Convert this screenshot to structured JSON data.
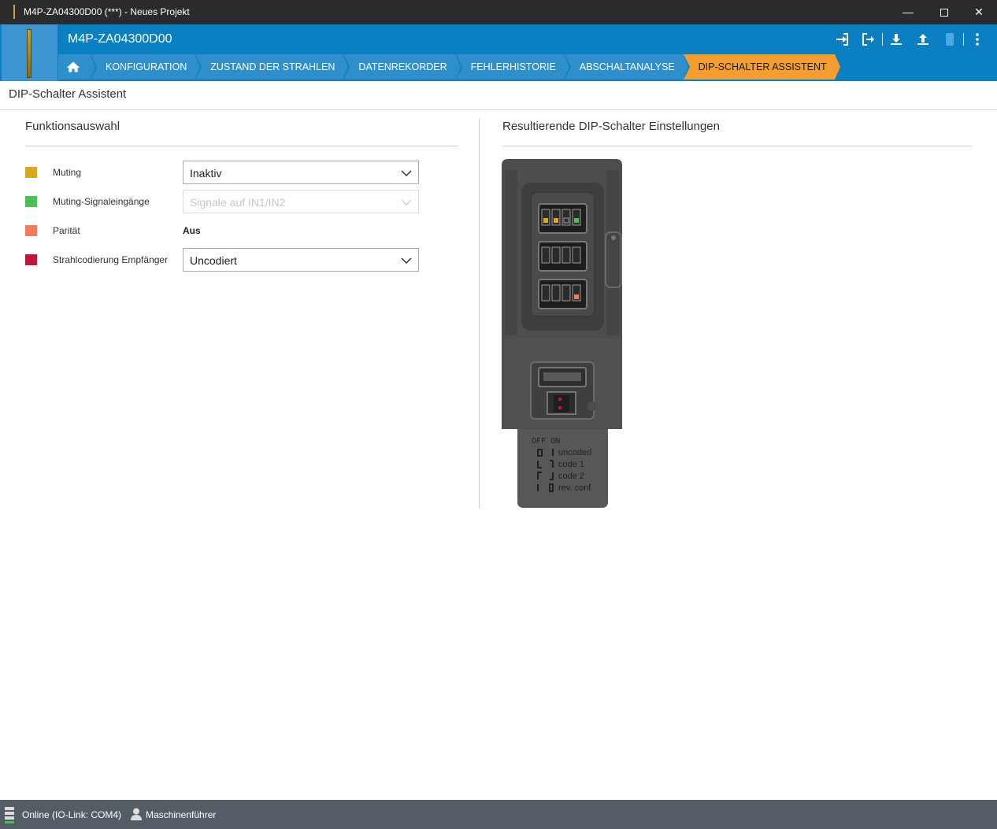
{
  "window": {
    "title": "M4P-ZA04300D00 (***) - Neues Projekt"
  },
  "header": {
    "device_name": "M4P-ZA04300D00",
    "icons": [
      "login-icon",
      "logout-icon",
      "download-icon",
      "upload-icon",
      "battery-icon",
      "more-vert-icon"
    ]
  },
  "nav": {
    "home_icon": "home-icon",
    "tabs": [
      {
        "label": "KONFIGURATION"
      },
      {
        "label": "ZUSTAND DER STRAHLEN"
      },
      {
        "label": "DATENREKORDER"
      },
      {
        "label": "FEHLERHISTORIE"
      },
      {
        "label": "ABSCHALTANALYSE"
      },
      {
        "label": "DIP-SCHALTER ASSISTENT",
        "active": true
      }
    ]
  },
  "page": {
    "title": "DIP-Schalter Assistent"
  },
  "left": {
    "title": "Funktionsauswahl",
    "rows": [
      {
        "label": "Muting",
        "color": "#d9a822",
        "value": "Inaktiv",
        "kind": "select"
      },
      {
        "label": "Muting-Signaleingänge",
        "color": "#4cbf55",
        "value": "Signale auf IN1/IN2",
        "kind": "select-disabled"
      },
      {
        "label": "Parität",
        "color": "#f27b5b",
        "value": "Aus",
        "kind": "static"
      },
      {
        "label": "Strahlcodierung Empfänger",
        "color": "#c0143c",
        "value": "Uncodiert",
        "kind": "select"
      }
    ]
  },
  "right": {
    "title": "Resultierende DIP-Schalter Einstellungen",
    "legend": {
      "header": "OFF  ON",
      "items": [
        "uncoded",
        "code 1",
        "code 2",
        "rev. conf."
      ]
    },
    "colors": {
      "muting": "#d9a822",
      "signal": "#4cbf55",
      "parity": "#f27b5b",
      "coding": "#c0143c"
    }
  },
  "status": {
    "connection": "Online (IO-Link: COM4)",
    "user": "Maschinenführer"
  }
}
